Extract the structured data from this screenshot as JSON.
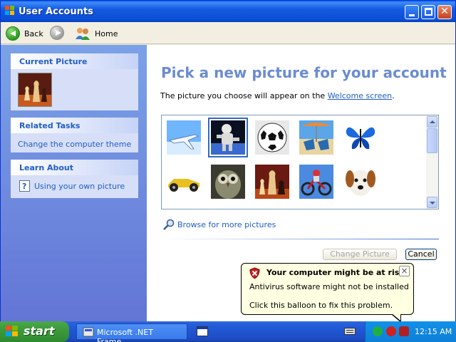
{
  "window": {
    "title": "User Accounts",
    "title_color": "#ffffff"
  },
  "toolbar": {
    "back_label": "Back",
    "home_label": "Home"
  },
  "sidebar": {
    "current_picture_header": "Current Picture",
    "current_picture_icon": "chess-pieces",
    "related_tasks_header": "Related Tasks",
    "related_tasks_link": "Change the computer theme",
    "learn_about_header": "Learn About",
    "learn_about_link": "Using your own picture"
  },
  "main": {
    "heading": "Pick a new picture for your account",
    "subtext_prefix": "The picture you choose will appear on the ",
    "subtext_link": "Welcome screen",
    "subtext_suffix": ".",
    "pictures": [
      {
        "name": "airplane",
        "selected": false
      },
      {
        "name": "astronaut",
        "selected": true
      },
      {
        "name": "soccer-ball",
        "selected": false
      },
      {
        "name": "beach-chairs",
        "selected": false
      },
      {
        "name": "butterfly",
        "selected": false
      },
      {
        "name": "race-car",
        "selected": false
      },
      {
        "name": "owl",
        "selected": false
      },
      {
        "name": "chess-pieces",
        "selected": false
      },
      {
        "name": "dirt-bike",
        "selected": false
      },
      {
        "name": "dog",
        "selected": false
      }
    ],
    "browse_label": "Browse for more pictures",
    "change_button": "Change Picture",
    "cancel_button": "Cancel"
  },
  "balloon": {
    "title": "Your computer might be at risk",
    "line1": "Antivirus software might not be installed",
    "line2": "Click this balloon to fix this problem.",
    "close_glyph": "×"
  },
  "taskbar": {
    "start_label": "start",
    "task_label": "Microsoft .NET Frame...",
    "clock": "12:15 AM"
  },
  "colors": {
    "heading": "#6b8ccf",
    "link": "#215dc6",
    "titlebar": "#0b4fd8",
    "taskbar": "#245edb",
    "start": "#3c9a3c",
    "balloon": "#ffffe1"
  }
}
